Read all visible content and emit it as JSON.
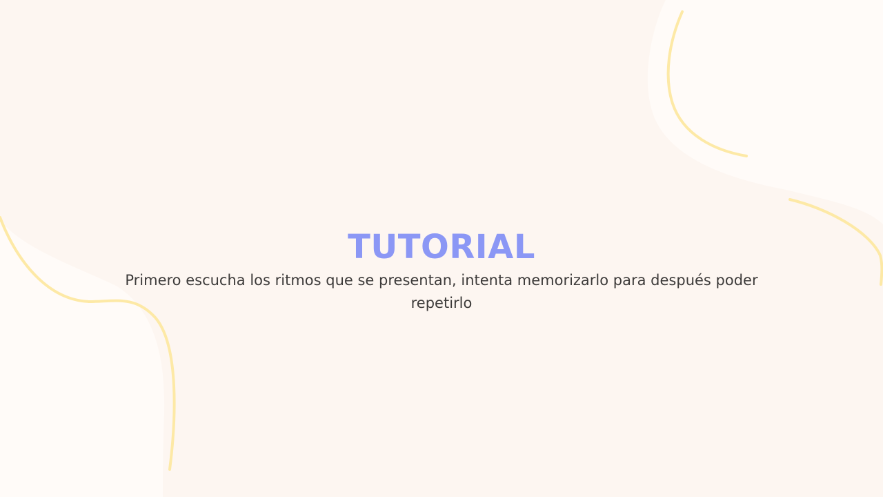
{
  "slide": {
    "title": "TUTORIAL",
    "description": "Primero escucha los ritmos que se presentan, intenta memorizarlo para después poder repetirlo"
  },
  "colors": {
    "background": "#fdf6f1",
    "blob": "#fffbf8",
    "accent_line": "#fde9a6",
    "title": "#8b97f5",
    "text": "#3d3b3a"
  }
}
